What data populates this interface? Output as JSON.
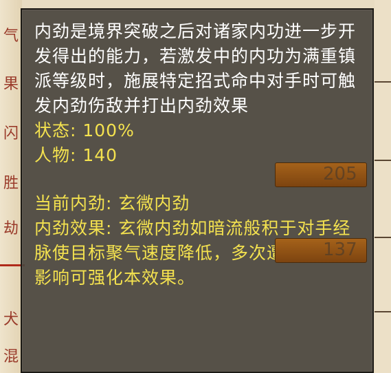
{
  "tooltip": {
    "description": "内劲是境界突破之后对诸家内功进一步开发得出的能力，若激发中的内功为满重镇派等级时，施展特定招式命中对手时可触发内劲伤敌并打出内劲效果",
    "status_line": "状态: 100%",
    "character_line": "人物: 140",
    "current_line": "当前内劲: 玄微内劲",
    "effect_line": "内劲效果: 玄微内劲如暗流般积于对手经脉使目标聚气速度降低，多次遭受本内劲影响可强化本效果。"
  },
  "background": {
    "left_glyphs": [
      "气",
      "果",
      "闪",
      "胜",
      "劫",
      "犬",
      "混"
    ],
    "bar_values": [
      "205",
      "137"
    ],
    "accent_colors": {
      "tooltip_text": "#ffffff",
      "tooltip_highlight": "#f4e24f",
      "bar_fill": "#a5621a"
    }
  }
}
